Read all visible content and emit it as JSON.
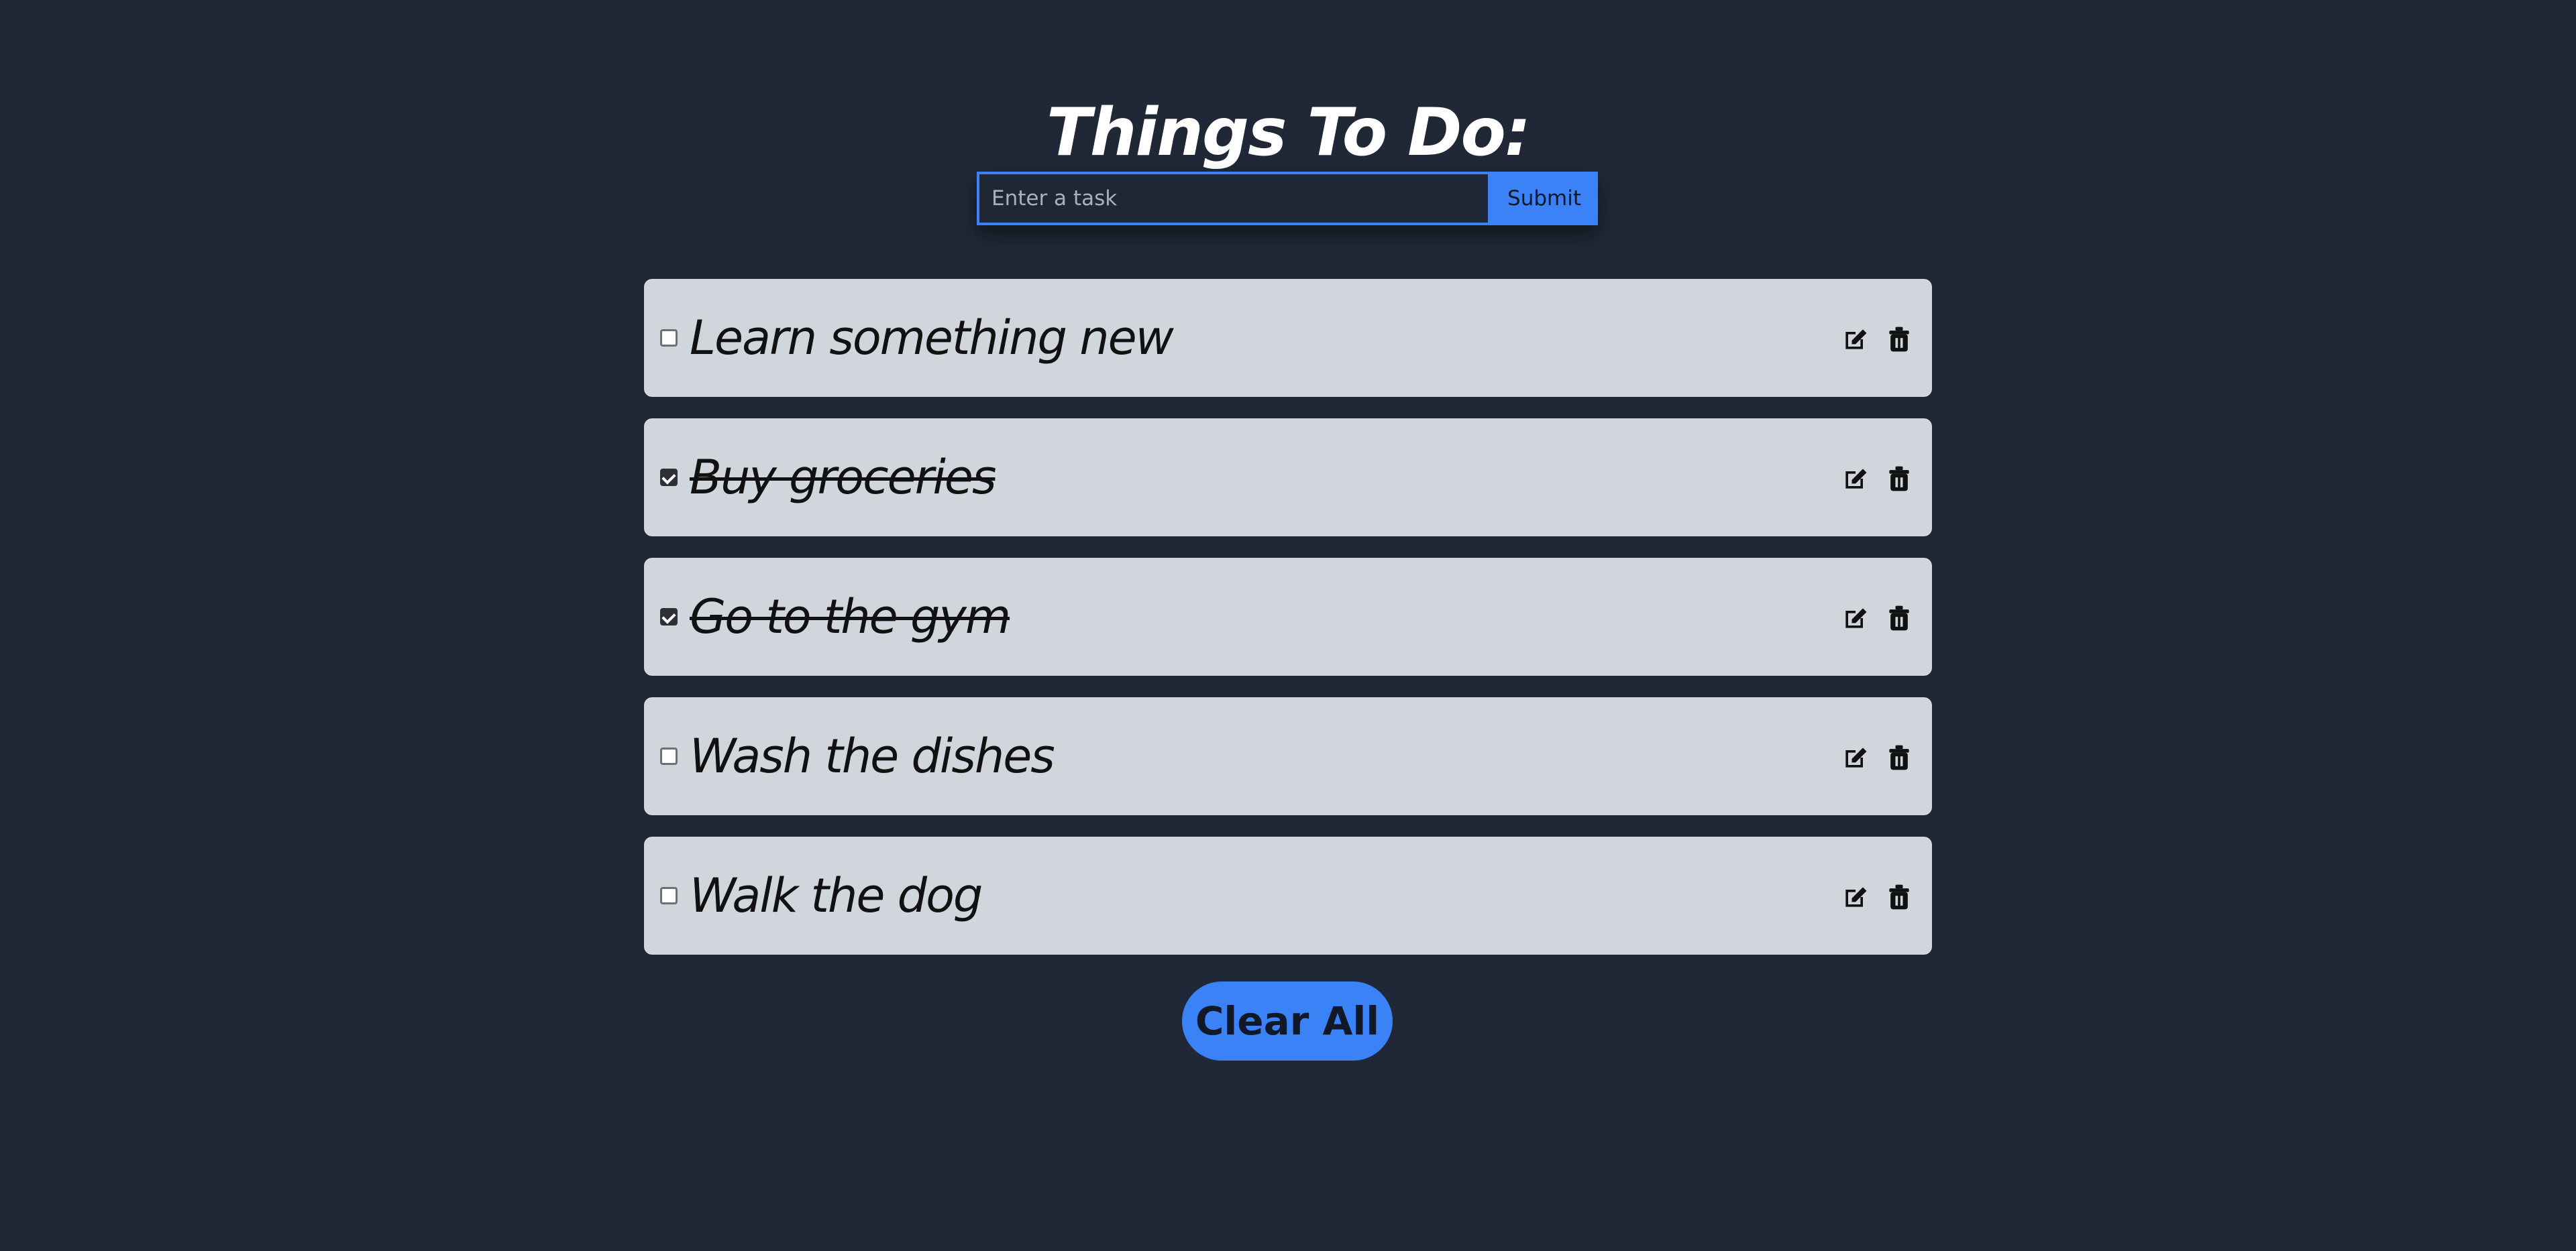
{
  "header": {
    "title": "Things To Do:"
  },
  "form": {
    "input_placeholder": "Enter a task",
    "input_value": "",
    "submit_label": "Submit"
  },
  "tasks": [
    {
      "text": "Learn something new",
      "completed": false
    },
    {
      "text": "Buy groceries",
      "completed": true
    },
    {
      "text": "Go to the gym",
      "completed": true
    },
    {
      "text": "Wash the dishes",
      "completed": false
    },
    {
      "text": "Walk the dog",
      "completed": false
    }
  ],
  "actions": {
    "clear_all_label": "Clear All"
  },
  "icons": {
    "edit": "edit-icon",
    "delete": "trash-icon",
    "checkbox": "checkbox-icon"
  },
  "colors": {
    "background": "#202837",
    "accent": "#3b82f6",
    "task_card": "#d1d5dc",
    "task_text": "#111111",
    "title": "#ffffff"
  }
}
